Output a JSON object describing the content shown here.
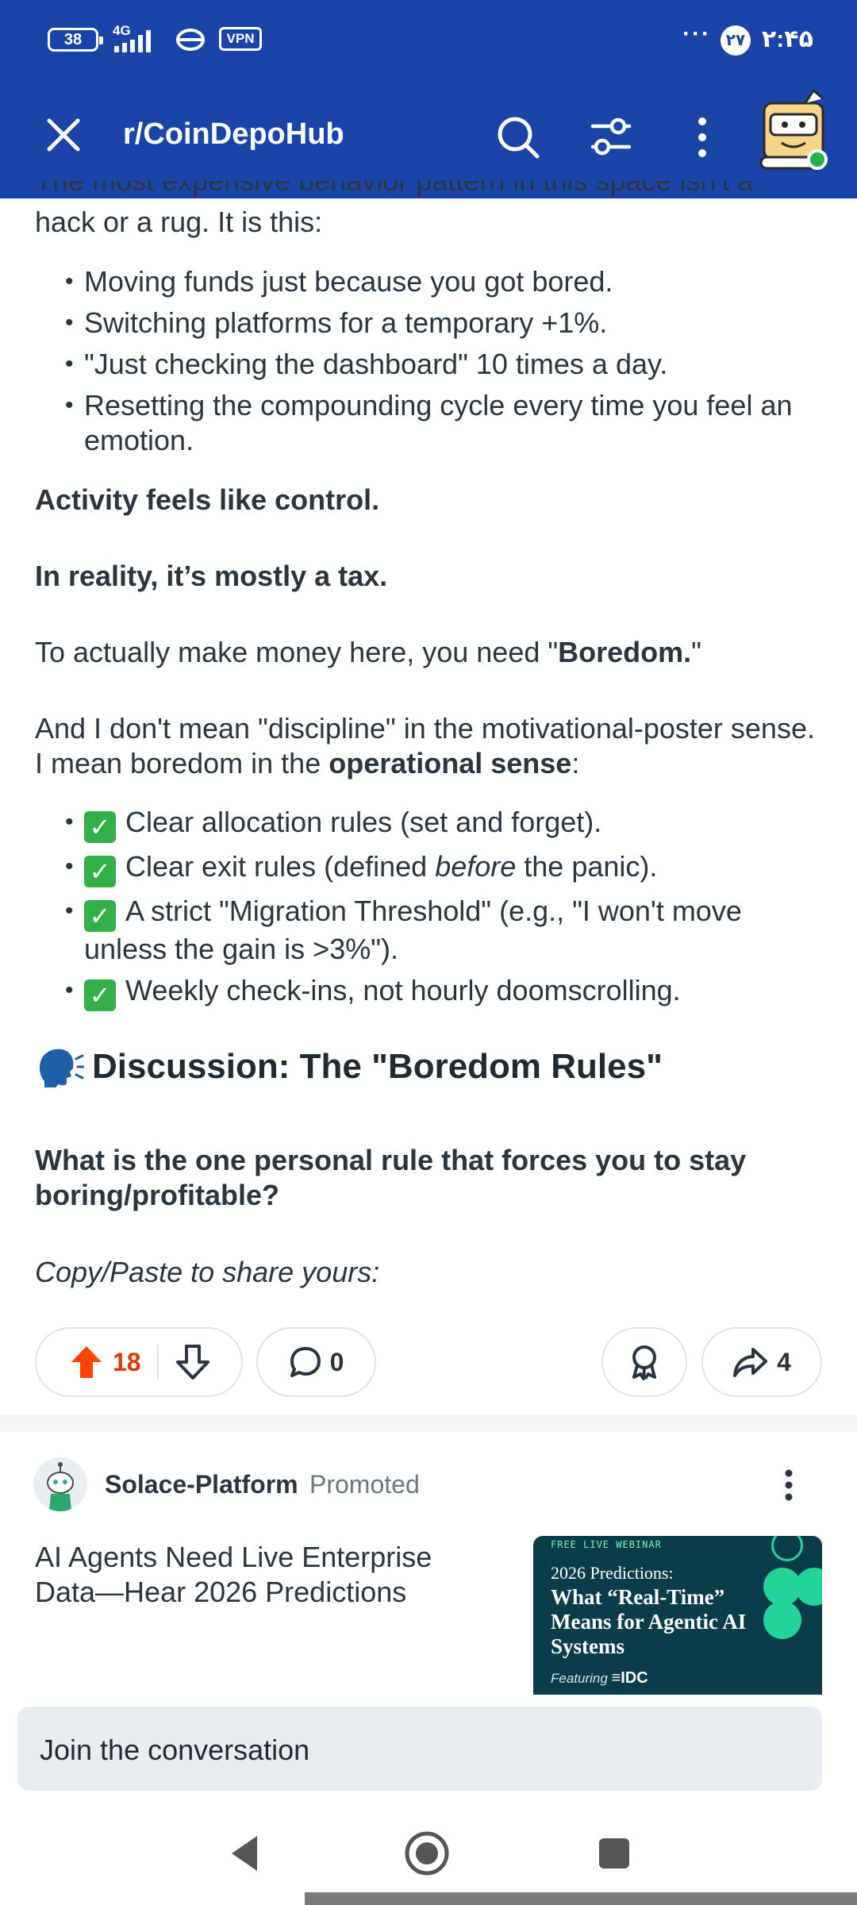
{
  "status_bar": {
    "battery": "38",
    "network": "4G",
    "vpn": "VPN",
    "dots": "···",
    "badge": "۲۷",
    "time": "۲:۴۵"
  },
  "app_bar": {
    "subreddit": "r/CoinDepoHub",
    "icons": [
      "close-icon",
      "search-icon",
      "filter-icon",
      "more-vertical-icon",
      "user-avatar"
    ]
  },
  "post": {
    "partial_line": "The most expensive behavior pattern in this space isn't a",
    "intro": "hack or a rug. It is this:",
    "bad_habits": [
      "Moving funds just because you got bored.",
      "Switching platforms for a temporary +1%.",
      "\"Just checking the dashboard\" 10 times a day.",
      "Resetting the compounding cycle every time you feel an emotion."
    ],
    "statement_1": "Activity feels like control.",
    "statement_2": "In reality, it’s mostly a tax.",
    "boredom_pre": "To actually make money here, you need \"",
    "boredom_word": "Boredom.",
    "boredom_post": "\"",
    "meaning_pre": "And I don't mean \"discipline\" in the motivational-poster sense. I mean boredom in the ",
    "meaning_bold": "operational sense",
    "meaning_post": ":",
    "rules": [
      {
        "check": "✓",
        "text": "Clear allocation rules (set and forget)."
      },
      {
        "check": "✓",
        "pre": "Clear exit rules (defined ",
        "em": "before",
        "post": " the panic)."
      },
      {
        "check": "✓",
        "text": "A strict \"Migration Threshold\" (e.g., \"I won't move unless the gain is >3%\")."
      },
      {
        "check": "✓",
        "text": "Weekly check-ins, not hourly doomscrolling."
      }
    ],
    "discussion_title": "Discussion: The \"Boredom Rules\"",
    "question": "What is the one personal rule that forces you to stay boring/profitable?",
    "copy_prompt": "Copy/Paste to share yours:"
  },
  "actions": {
    "upvotes": "18",
    "comments": "0",
    "shares": "4"
  },
  "promoted": {
    "author": "Solace-Platform",
    "tag": "Promoted",
    "headline": "AI Agents Need Live Enterprise Data—Hear 2026 Predictions",
    "card": {
      "kicker": "FREE LIVE WEBINAR",
      "subtitle": "2026 Predictions:",
      "title": "What “Real-Time” Means for Agentic AI Systems",
      "featuring": "Featuring",
      "brand": "IDC"
    }
  },
  "composer": {
    "placeholder": "Join the conversation"
  },
  "colors": {
    "app_bar": "#1a44a8",
    "upvote": "#ff4500",
    "upvote_count": "#d93a00",
    "check": "#33b04a",
    "card_bg": "#0a3d4a",
    "card_accent": "#22d39a"
  }
}
